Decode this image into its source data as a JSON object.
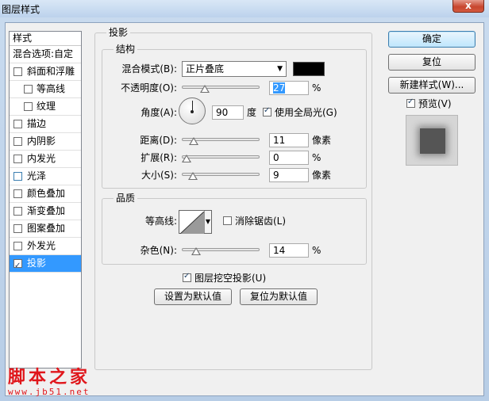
{
  "window": {
    "title": "图层样式",
    "close_label": "x"
  },
  "styles_list": {
    "header": "样式",
    "blend_options": "混合选项:自定",
    "items": [
      {
        "label": "斜面和浮雕",
        "checked": false
      },
      {
        "label": "等高线",
        "checked": false
      },
      {
        "label": "纹理",
        "checked": false
      },
      {
        "label": "描边",
        "checked": false
      },
      {
        "label": "内阴影",
        "checked": false
      },
      {
        "label": "内发光",
        "checked": false
      },
      {
        "label": "光泽",
        "checked": false
      },
      {
        "label": "颜色叠加",
        "checked": false
      },
      {
        "label": "渐变叠加",
        "checked": false
      },
      {
        "label": "图案叠加",
        "checked": false
      },
      {
        "label": "外发光",
        "checked": false
      },
      {
        "label": "投影",
        "checked": true
      }
    ]
  },
  "drop_shadow": {
    "title": "投影",
    "structure": {
      "title": "结构",
      "blend_mode_label": "混合模式(B):",
      "blend_mode_value": "正片叠底",
      "shadow_color": "#000000",
      "opacity_label": "不透明度(O):",
      "opacity_value": "27",
      "opacity_slider": 27,
      "percent": "%",
      "angle_label": "角度(A):",
      "angle_value": "90",
      "angle_unit": "度",
      "global_light_label": "使用全局光(G)",
      "global_light_checked": true,
      "distance_label": "距离(D):",
      "distance_value": "11",
      "distance_slider": 11,
      "pixels": "像素",
      "spread_label": "扩展(R):",
      "spread_value": "0",
      "spread_slider": 0,
      "size_label": "大小(S):",
      "size_value": "9",
      "size_slider": 9
    },
    "quality": {
      "title": "品质",
      "contour_label": "等高线:",
      "anti_alias_label": "消除锯齿(L)",
      "anti_alias_checked": false,
      "noise_label": "杂色(N):",
      "noise_value": "14",
      "noise_slider": 14
    },
    "knockout_label": "图层挖空投影(U)",
    "knockout_checked": true,
    "make_default_label": "设置为默认值",
    "reset_default_label": "复位为默认值"
  },
  "buttons": {
    "ok": "确定",
    "reset": "复位",
    "new_style": "新建样式(W)...",
    "preview_label": "预览(V)",
    "preview_checked": true
  },
  "watermark": {
    "text": "脚本之家",
    "url": "www.jb51.net"
  },
  "colors": {
    "selection": "#3399ff",
    "watermark": "#e0161b"
  }
}
